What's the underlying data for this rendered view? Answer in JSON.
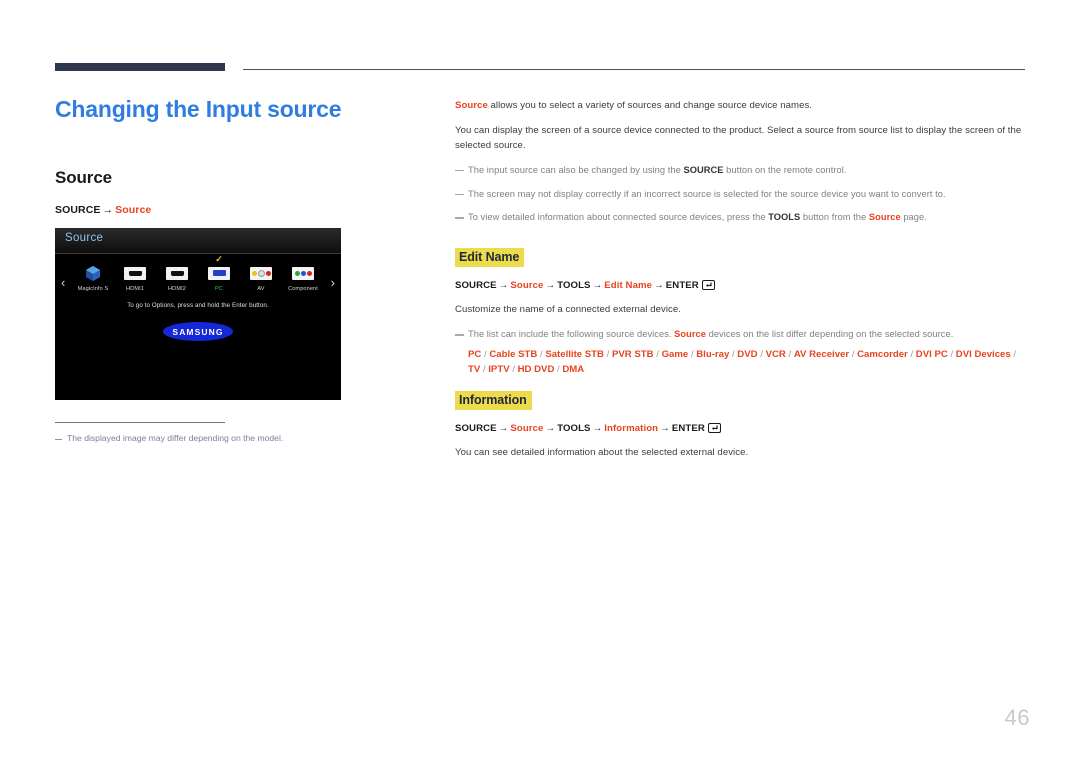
{
  "document": {
    "page_number": "46",
    "title": "Changing the Input source"
  },
  "left": {
    "section_heading": "Source",
    "nav_path": {
      "step1": "SOURCE",
      "arrow": "→",
      "step2": "Source"
    },
    "footnote": "The displayed image may differ depending on the model.",
    "osd": {
      "header_title": "Source",
      "arrow_left": "‹",
      "arrow_right": "›",
      "hint": "To go to Options, press and hold the Enter button.",
      "brand": "SAMSUNG",
      "check_mark": "✓",
      "devices": [
        {
          "label": "MagicInfo S",
          "icon": "magicinfo-cube-icon",
          "selected": false
        },
        {
          "label": "HDMI1",
          "icon": "hdmi-connector-icon",
          "selected": false
        },
        {
          "label": "HDMI2",
          "icon": "hdmi-connector-icon",
          "selected": false
        },
        {
          "label": "PC",
          "icon": "vga-connector-icon",
          "selected": true
        },
        {
          "label": "AV",
          "icon": "av-rca-connector-icon",
          "selected": false
        },
        {
          "label": "Component",
          "icon": "component-rca-connector-icon",
          "selected": false
        }
      ]
    }
  },
  "right": {
    "intro": {
      "keyword": "Source",
      "text": " allows you to select a variety of sources and change source device names."
    },
    "paragraph": "You can display the screen of a source device connected to the product. Select a source from source list to display the screen of the selected source.",
    "notes": [
      {
        "pre": "The input source can also be changed by using the ",
        "bold": "SOURCE",
        "post": " button on the remote control."
      },
      {
        "pre": "The screen may not display correctly if an incorrect source is selected for the source device you want to convert to.",
        "bold": "",
        "post": ""
      },
      {
        "pre": "To view detailed information about connected source devices, press the ",
        "bold": "TOOLS",
        "mid": " button from the ",
        "red": "Source",
        "post": " page."
      }
    ],
    "edit_name": {
      "title": "Edit Name",
      "path": {
        "step1": "SOURCE",
        "step2": "Source",
        "step3": "TOOLS",
        "step4": "Edit Name",
        "step5": "ENTER",
        "arrow": "→",
        "enter_icon": "enter-key-icon"
      },
      "description": "Customize the name of a connected external device.",
      "note": {
        "pre": "The list can include the following source devices. ",
        "red": "Source",
        "post": " devices on the list differ depending on the selected source."
      },
      "device_list": [
        "PC",
        "Cable STB",
        "Satellite STB",
        "PVR STB",
        "Game",
        "Blu-ray",
        "DVD",
        "VCR",
        "AV Receiver",
        "Camcorder",
        "DVI PC",
        "DVI Devices",
        "TV",
        "IPTV",
        "HD DVD",
        "DMA"
      ],
      "device_list_separator": "/"
    },
    "information": {
      "title": "Information",
      "path": {
        "step1": "SOURCE",
        "step2": "Source",
        "step3": "TOOLS",
        "step4": "Information",
        "step5": "ENTER",
        "arrow": "→",
        "enter_icon": "enter-key-icon"
      },
      "description": "You can see detailed information about the selected external device."
    }
  },
  "colors": {
    "accent_blue": "#2f7de1",
    "keyword_red": "#e8431f",
    "highlight_yellow": "#ecdb4a",
    "rule_navy": "#2e3650",
    "selected_green": "#35c94a",
    "check_yellow": "#f2c12e",
    "samsung_blue": "#1428d8"
  }
}
